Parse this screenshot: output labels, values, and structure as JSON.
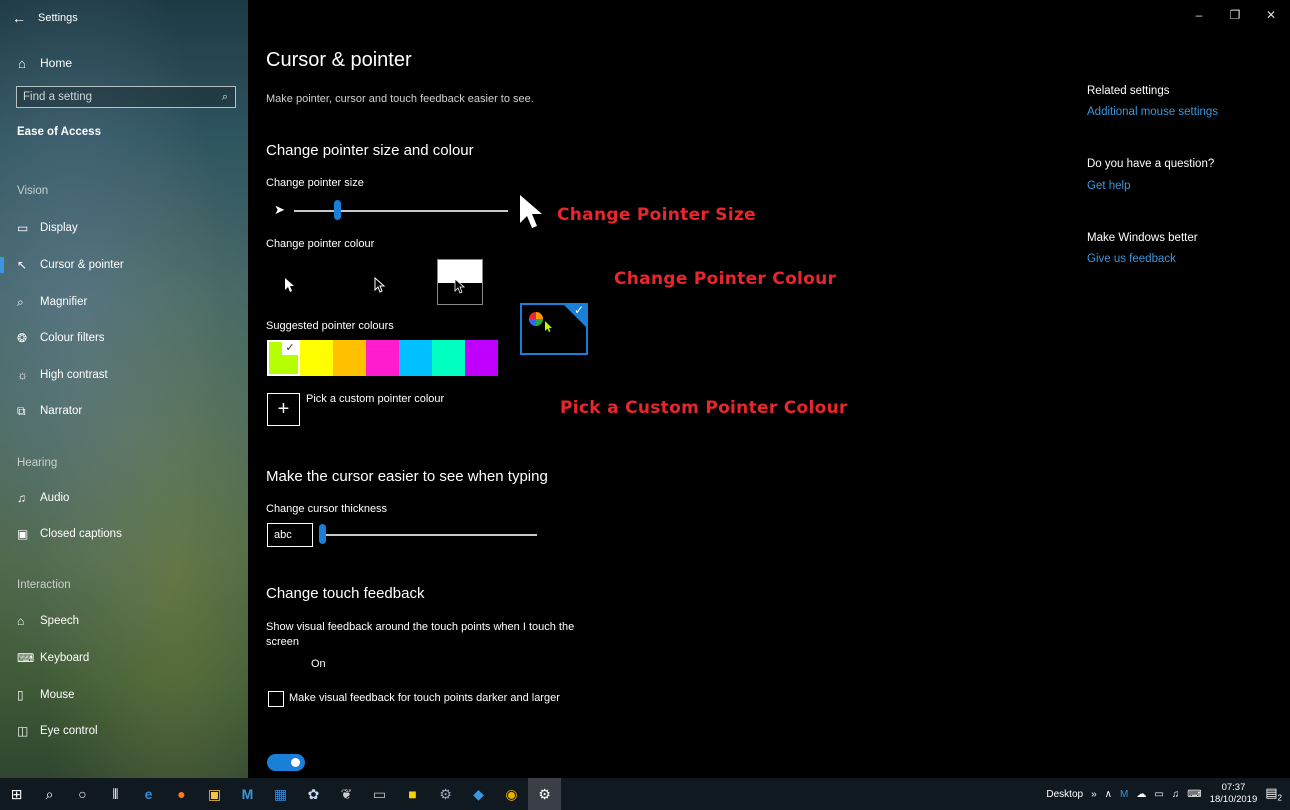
{
  "window": {
    "app_title": "Settings",
    "back_icon": "←",
    "minimize_icon": "–",
    "restore_icon": "❐",
    "close_icon": "✕"
  },
  "sidebar": {
    "home": {
      "label": "Home",
      "icon": "⌂"
    },
    "search": {
      "placeholder": "Find a setting",
      "icon": "⌕"
    },
    "section_title": "Ease of Access",
    "groups": {
      "vision": "Vision",
      "hearing": "Hearing",
      "interaction": "Interaction"
    },
    "items": [
      {
        "label": "Display",
        "icon": "▭",
        "selected": false
      },
      {
        "label": "Cursor & pointer",
        "icon": "↖",
        "selected": true
      },
      {
        "label": "Magnifier",
        "icon": "⌕",
        "selected": false
      },
      {
        "label": "Colour filters",
        "icon": "❂",
        "selected": false
      },
      {
        "label": "High contrast",
        "icon": "☼",
        "selected": false
      },
      {
        "label": "Narrator",
        "icon": "⧉",
        "selected": false
      },
      {
        "label": "Audio",
        "icon": "♫",
        "selected": false
      },
      {
        "label": "Closed captions",
        "icon": "▣",
        "selected": false
      },
      {
        "label": "Speech",
        "icon": "⌂",
        "selected": false
      },
      {
        "label": "Keyboard",
        "icon": "⌨",
        "selected": false
      },
      {
        "label": "Mouse",
        "icon": "▯",
        "selected": false
      },
      {
        "label": "Eye control",
        "icon": "◫",
        "selected": false
      }
    ]
  },
  "main": {
    "title": "Cursor & pointer",
    "description": "Make pointer, cursor and touch feedback easier to see.",
    "pointer_section": {
      "heading": "Change pointer size and colour",
      "size_label": "Change pointer size",
      "size_level": 0.2,
      "colour_label": "Change pointer colour",
      "suggested_label": "Suggested pointer colours",
      "swatches": [
        "#b4ff00",
        "#ffff00",
        "#ffc000",
        "#ff1ccf",
        "#00c0ff",
        "#00ffc0",
        "#c000ff"
      ],
      "custom_label": "Pick a custom pointer colour",
      "plus_icon": "+"
    },
    "cursor_section": {
      "heading": "Make the cursor easier to see when typing",
      "thickness_label": "Change cursor thickness",
      "preview_text": "abc",
      "thickness_level": 0.0
    },
    "touch_section": {
      "heading": "Change touch feedback",
      "show_feedback_label": "Show visual feedback around the touch points when I touch the screen",
      "toggle_state": "On",
      "darker_label": "Make visual feedback for touch points darker and larger"
    }
  },
  "annotations": {
    "size": "Change Pointer Size",
    "colour": "Change Pointer Colour",
    "custom": "Pick a Custom Pointer Colour"
  },
  "related": {
    "heading": "Related settings",
    "link": "Additional mouse settings",
    "question_heading": "Do you have a question?",
    "help_link": "Get help",
    "better_heading": "Make Windows better",
    "feedback_link": "Give us feedback"
  },
  "taskbar": {
    "desktop_label": "Desktop",
    "time": "07:37",
    "date": "18/10/2019",
    "notification_count": "2",
    "colors": {
      "accent": "#1a7fd6",
      "link": "#3a96dd",
      "annotation": "#e8262c"
    }
  }
}
